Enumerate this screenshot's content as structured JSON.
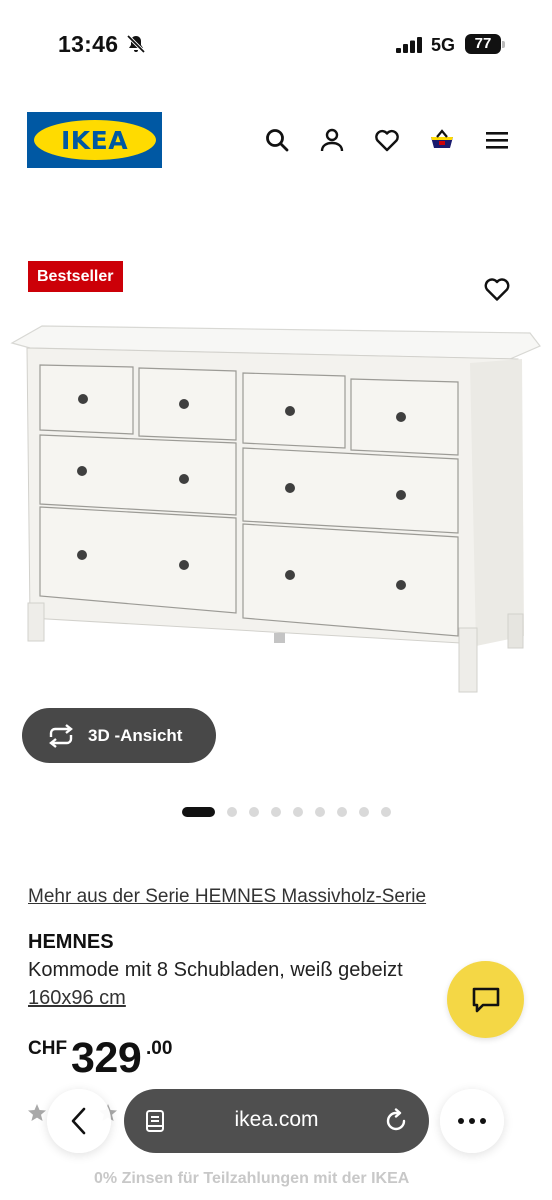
{
  "status_bar": {
    "time": "13:46",
    "network": "5G",
    "battery": "77"
  },
  "header": {
    "logo": "IKEA"
  },
  "product": {
    "badge": "Bestseller",
    "view3d_label": "3D -Ansicht",
    "carousel": {
      "total": 9,
      "active": 0
    },
    "series_link": "Mehr aus der Serie HEMNES Massivholz-Serie",
    "name": "HEMNES",
    "description": "Kommode mit 8 Schubladen, weiß gebeizt",
    "size": "160x96 cm",
    "price": {
      "currency": "CHF",
      "main": "329",
      "decimals": ".00"
    }
  },
  "browser": {
    "url": "ikea.com"
  },
  "finance_note": "0% Zinsen für Teilzahlungen mit der IKEA",
  "colors": {
    "ikea_blue": "#0058a3",
    "ikea_yellow": "#ffdb00",
    "badge_red": "#cc0008",
    "chat_yellow": "#f4d745"
  },
  "icons": [
    "bell-slash-icon",
    "signal-icon",
    "search-icon",
    "user-icon",
    "heart-icon",
    "basket-icon",
    "menu-icon",
    "rotate-icon",
    "chat-icon",
    "back-icon",
    "reader-icon",
    "reload-icon",
    "more-icon"
  ]
}
